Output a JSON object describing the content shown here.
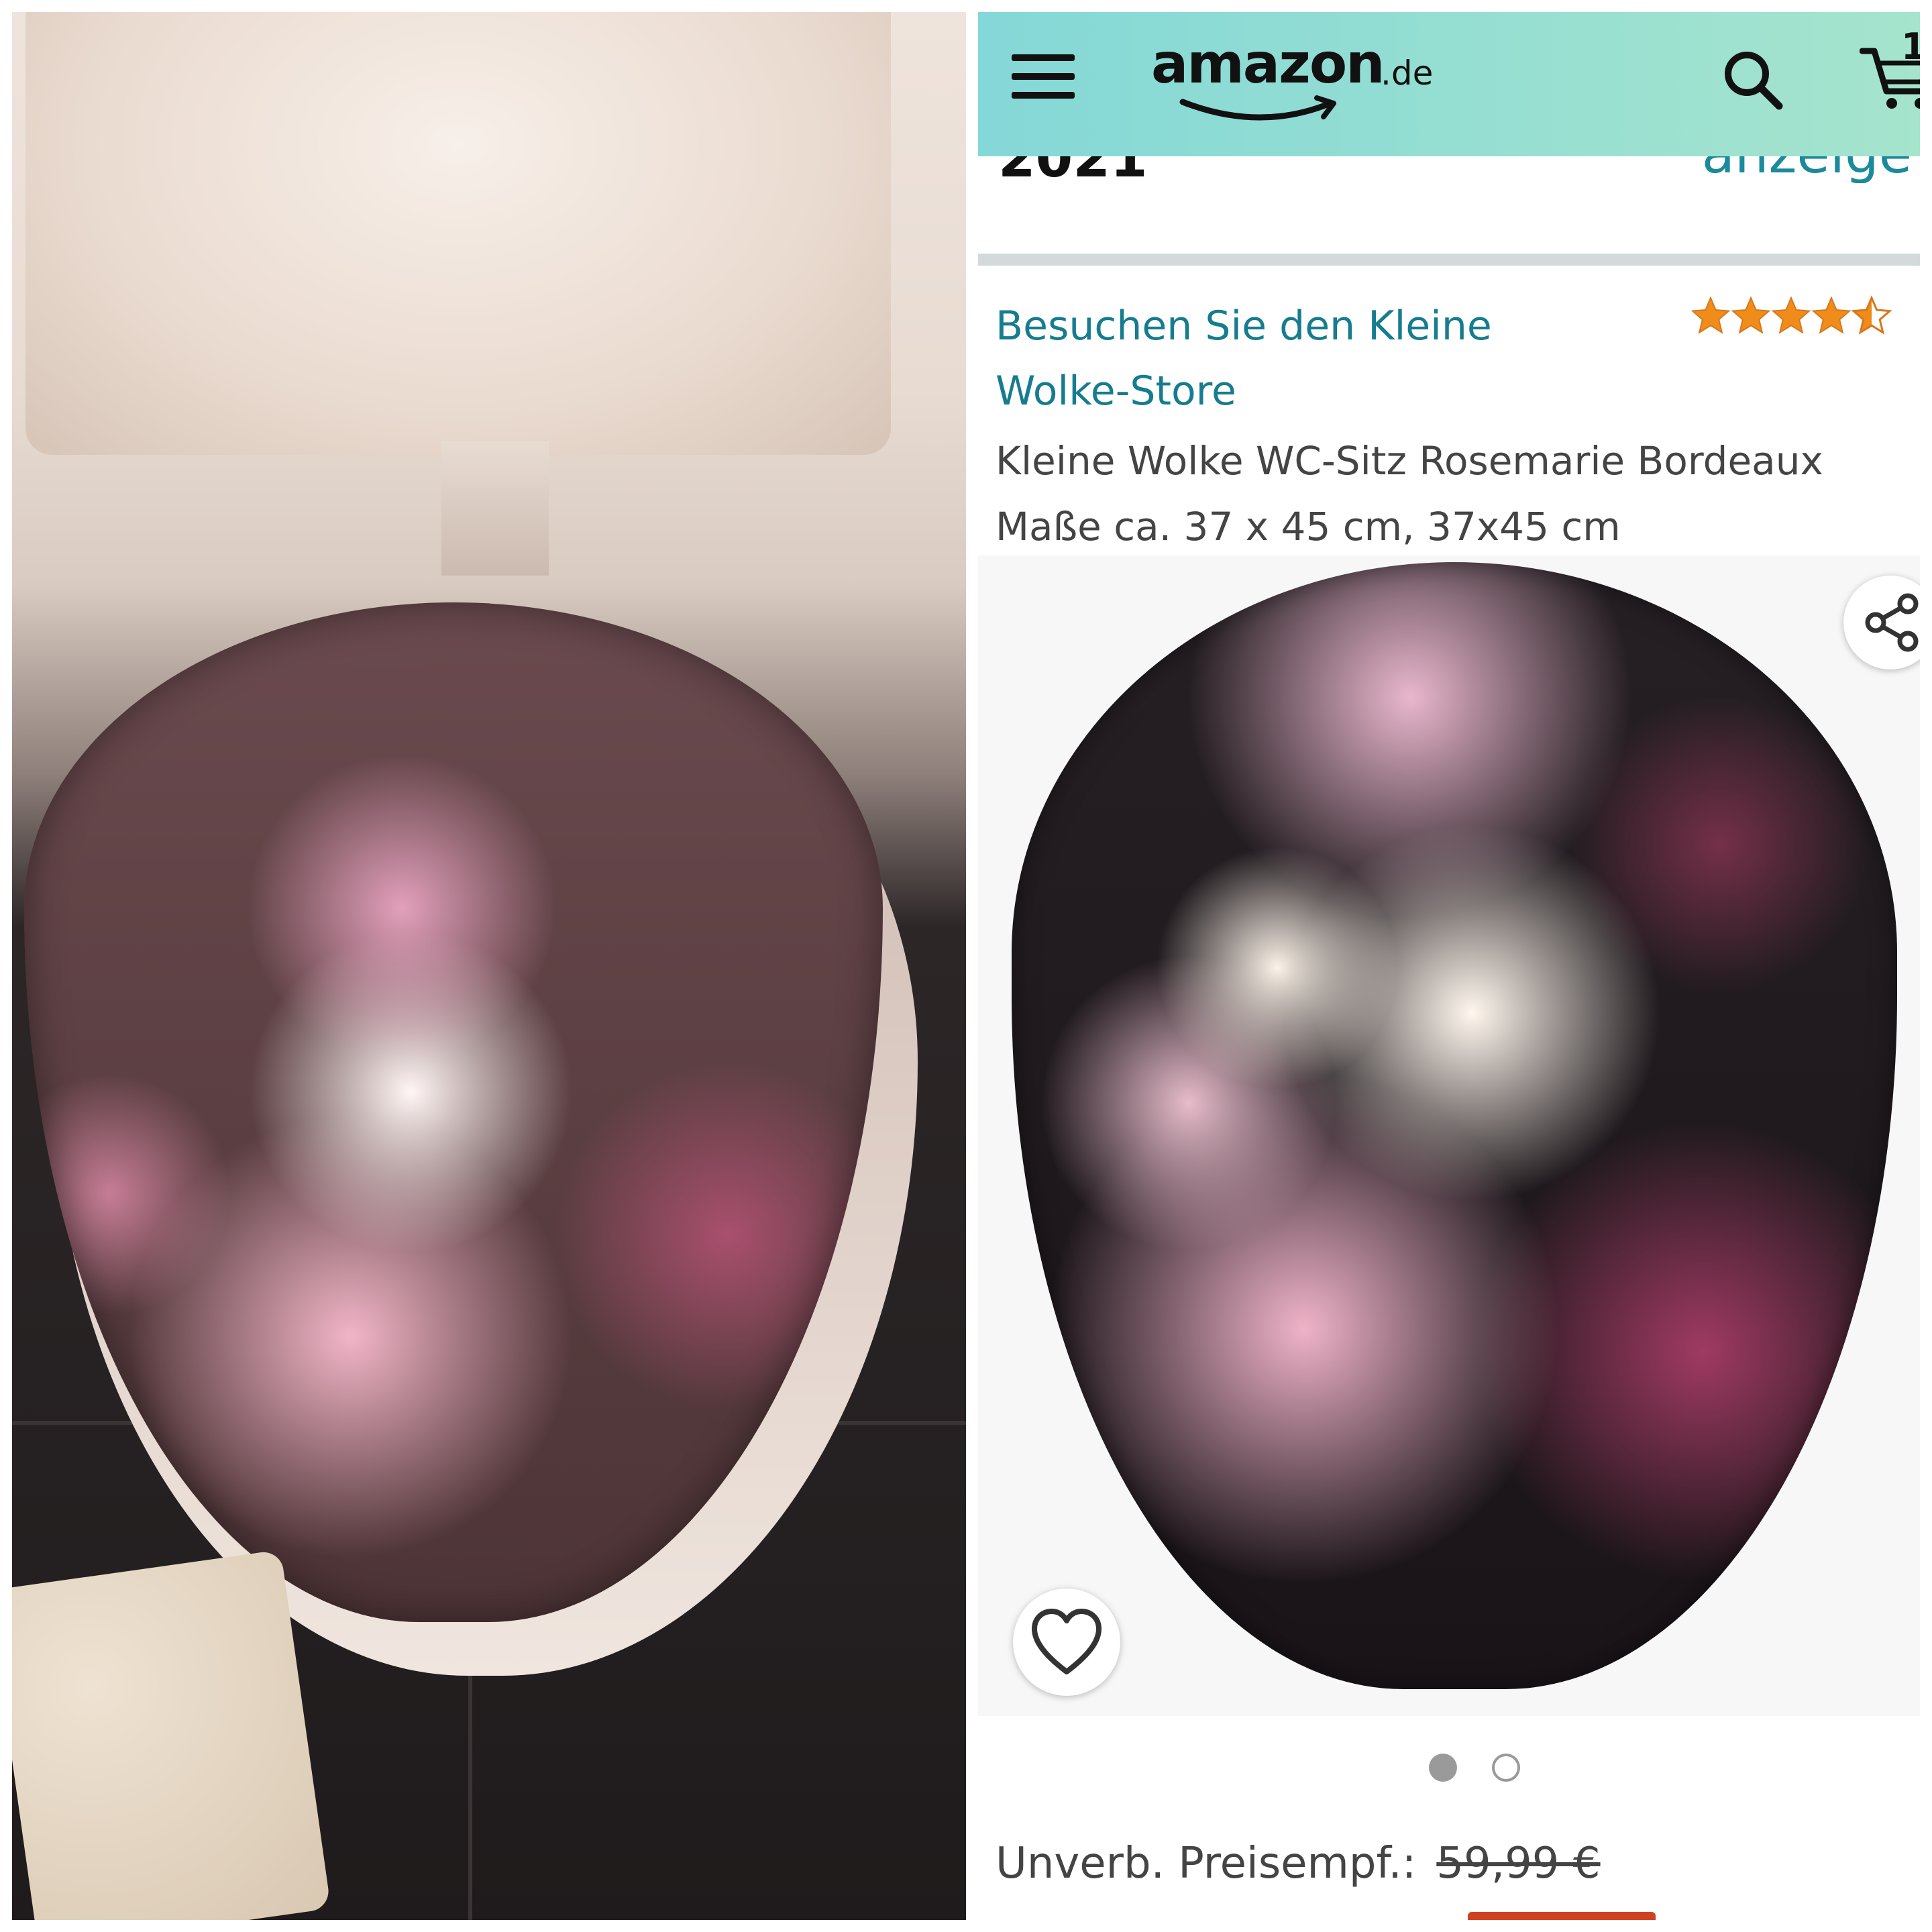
{
  "header": {
    "logo_text": "amazon",
    "logo_tld": ".de",
    "cart_count": "1"
  },
  "clipped": {
    "left_text": "2021",
    "right_text": "anzeige"
  },
  "product": {
    "store_link": "Besuchen Sie den Kleine Wolke-Store",
    "rating_stars": 4.5,
    "title": "Kleine Wolke WC-Sitz Rosemarie Bordeaux Maße ca. 37 x 45 cm, 37x45 cm",
    "image_count": 2,
    "active_image": 1,
    "price_label": "Unverb. Preisempf.:",
    "price_old": "59,99 €"
  },
  "colors": {
    "header_gradient_start": "#84d8d7",
    "header_gradient_end": "#a5e4cd",
    "link": "#167c8f",
    "star": "#f08c1a"
  },
  "icons": [
    "menu-icon",
    "search-icon",
    "cart-icon",
    "share-icon",
    "heart-icon",
    "star-icon"
  ]
}
